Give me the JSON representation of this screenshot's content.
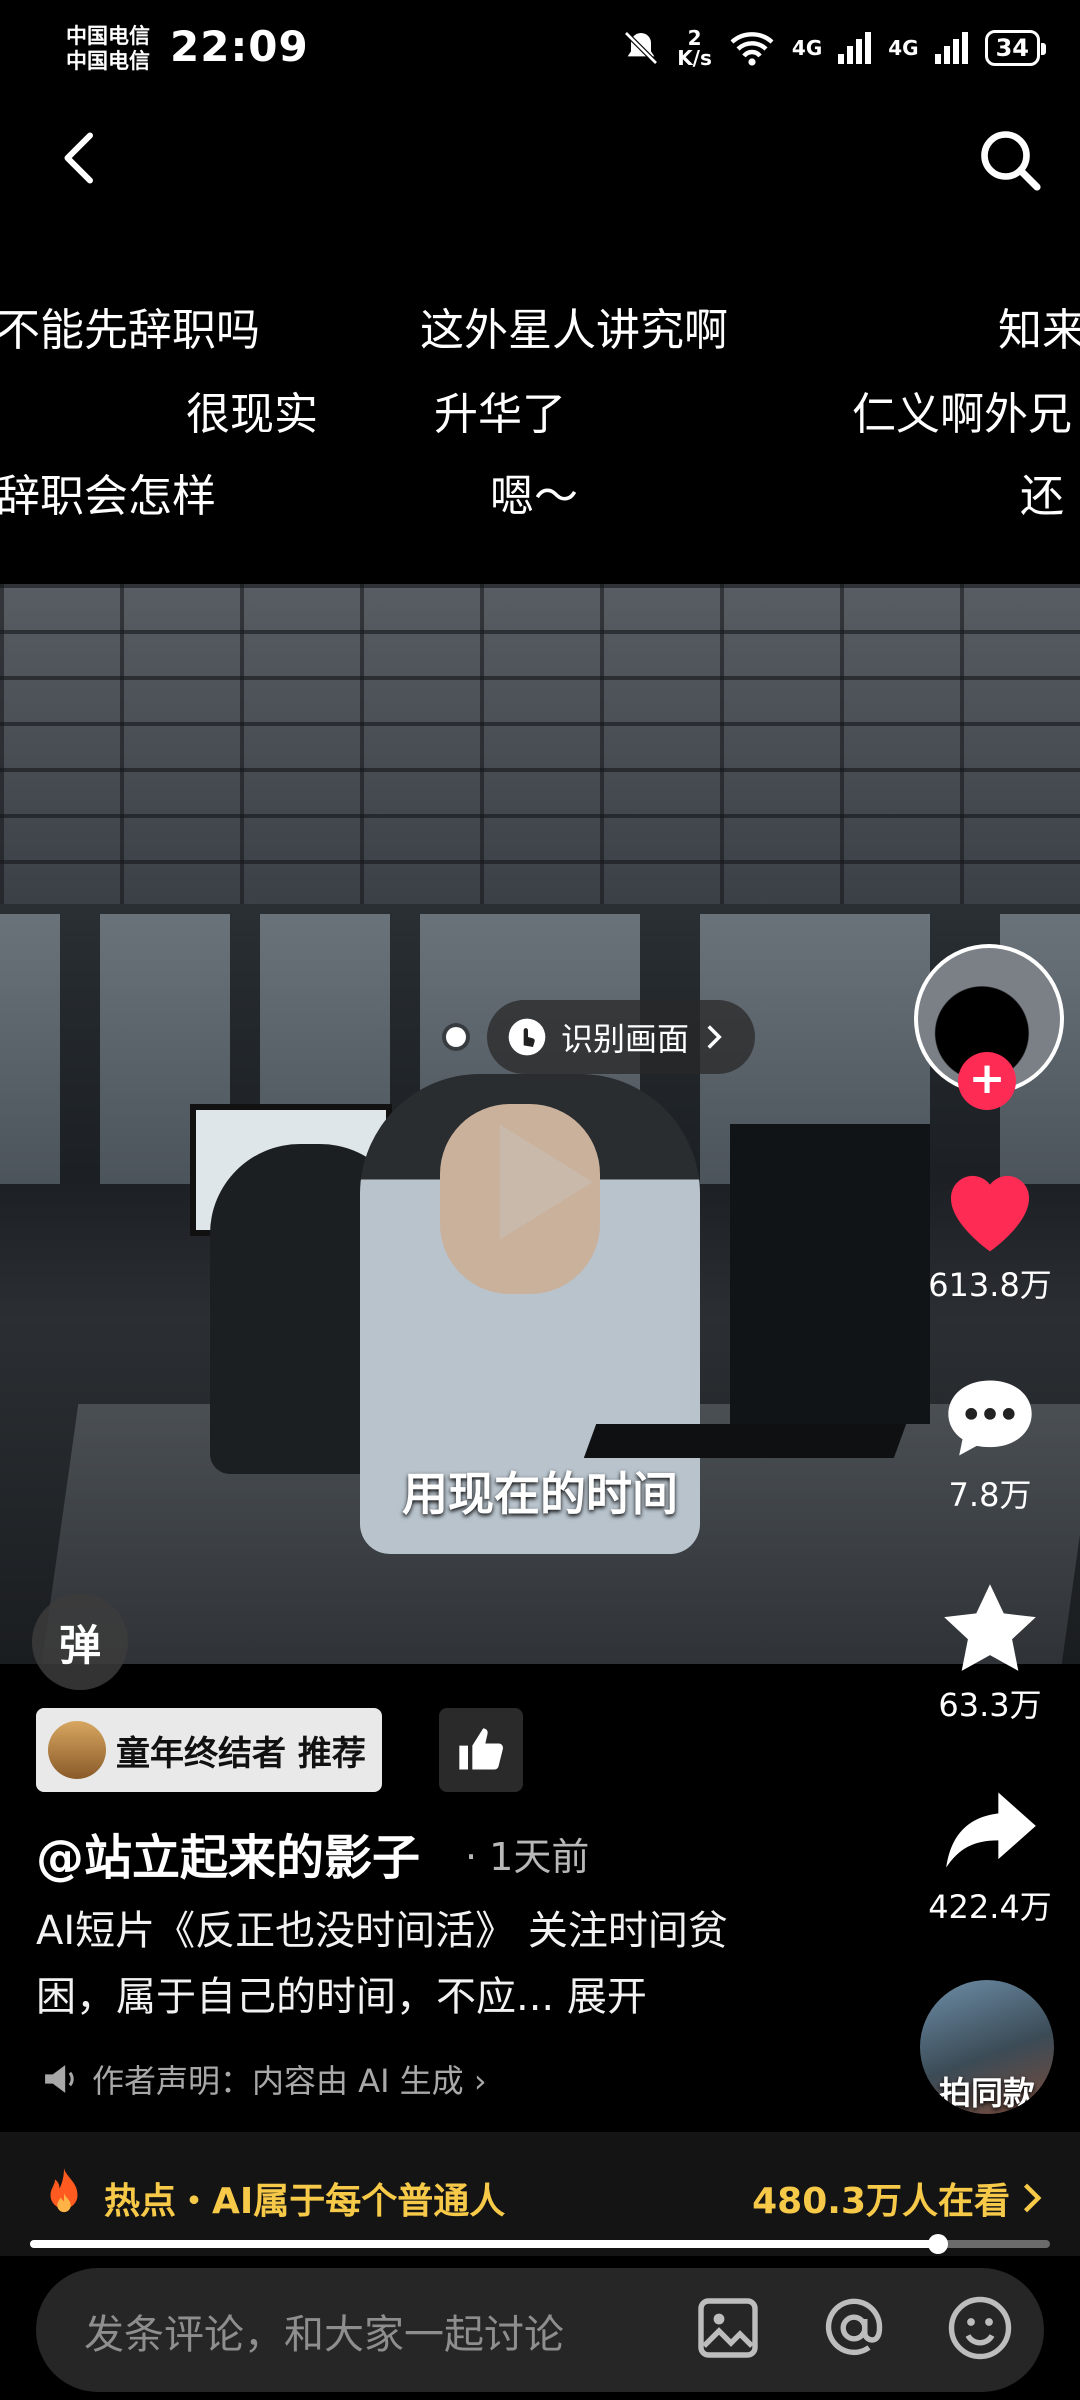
{
  "status_bar": {
    "carrier1": "中国电信",
    "carrier2": "中国电信",
    "time": "22:09",
    "net_speed_value": "2",
    "net_speed_unit": "K/s",
    "signal1": "4G",
    "signal2": "4G",
    "battery": "34"
  },
  "danmaku": [
    "不能先辞职吗",
    "这外星人讲究啊",
    "知来",
    "很现实",
    "升华了",
    "仁义啊外兄",
    "辞职会怎样",
    "嗯～",
    "还"
  ],
  "video": {
    "recognize_label": "识别画面",
    "subtitle": "用现在的时间",
    "danmu_toggle": "弹"
  },
  "actions": {
    "likes": "613.8万",
    "comments": "7.8万",
    "favorites": "63.3万",
    "shares": "422.4万",
    "sync_label": "拍同款"
  },
  "post": {
    "recommend_tag": "童年终结者 推荐",
    "author": "@站立起来的影子",
    "time": "· 1天前",
    "description": "AI短片《反正也没时间活》 关注时间贫困，属于自己的时间，不应... 展开",
    "declaration": "作者声明：内容由 AI 生成 ›"
  },
  "hot": {
    "label": "热点・AI属于每个普通人",
    "watching": "480.3万人在看",
    "progress": 0.89
  },
  "comment_bar": {
    "placeholder": "发条评论，和大家一起讨论"
  },
  "colors": {
    "accent_red": "#fe2c55",
    "hot_yellow": "#f7c948"
  }
}
